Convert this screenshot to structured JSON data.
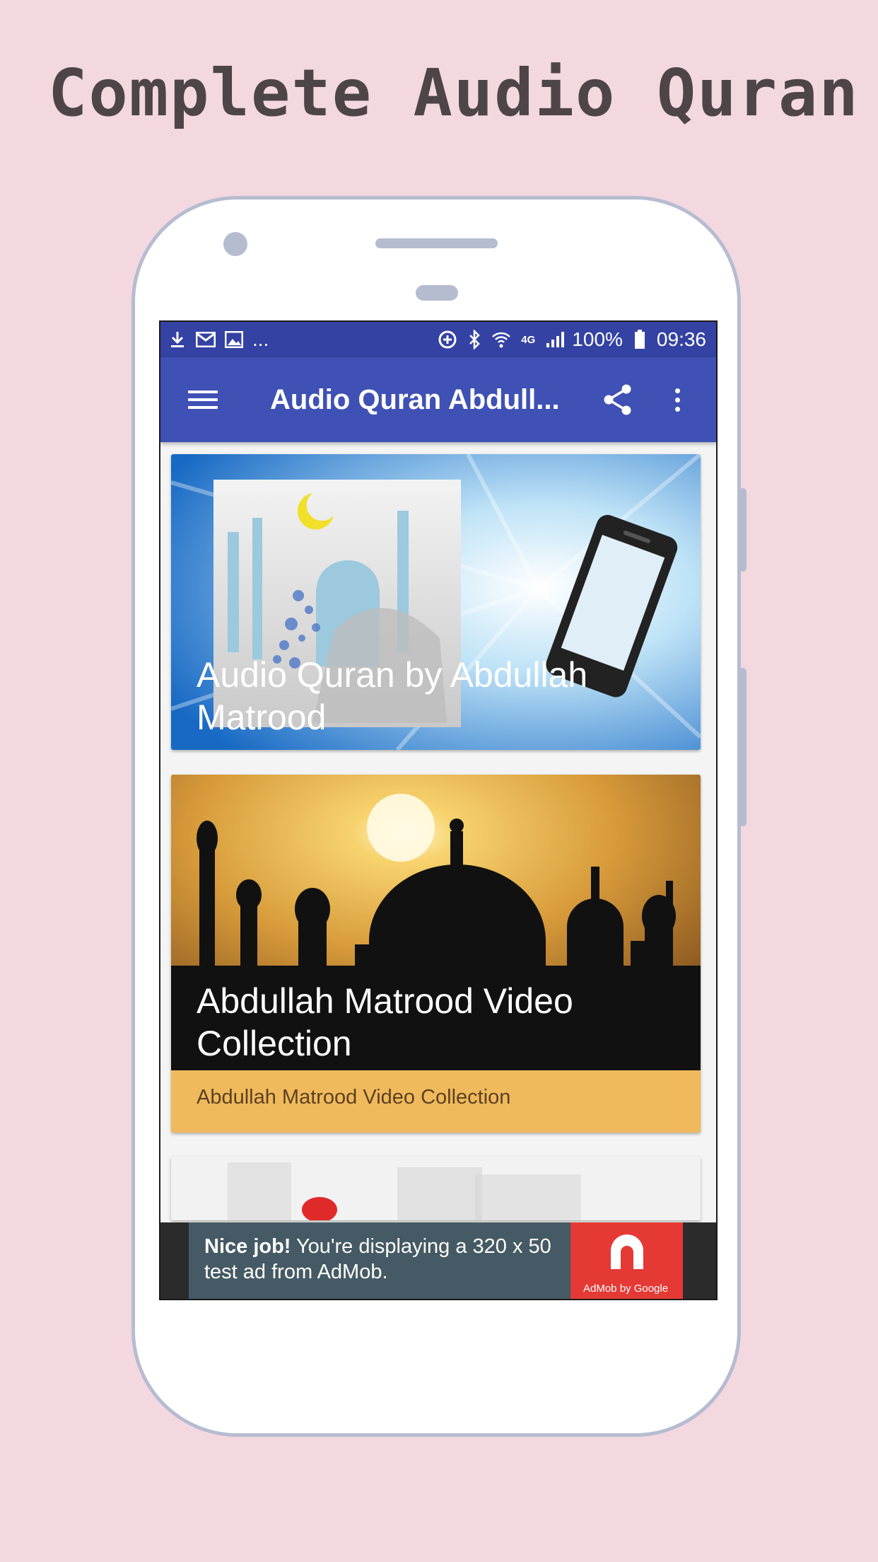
{
  "headline": "Complete Audio Quran",
  "status_bar": {
    "ellipsis": "...",
    "battery": "100%",
    "time": "09:36",
    "icons": [
      "download-icon",
      "gmail-icon",
      "image-icon",
      "sync-icon",
      "bluetooth-icon",
      "wifi-icon",
      "4g-icon",
      "signal-icon",
      "battery-icon"
    ]
  },
  "app_bar": {
    "title": "Audio Quran Abdull...",
    "icons": [
      "menu-icon",
      "share-icon",
      "more-vert-icon"
    ]
  },
  "cards": [
    {
      "title": "Audio Quran by Abdullah Matrood"
    },
    {
      "title": "Abdullah Matrood Video Collection",
      "subtitle": "Abdullah Matrood Video Collection"
    }
  ],
  "ad": {
    "bold": "Nice job!",
    "text": " You're displaying a 320 x 50 test ad from AdMob.",
    "logo_text": "AdMob by Google"
  },
  "colors": {
    "background": "#f3d8df",
    "status_bar": "#3442a3",
    "app_bar": "#3f51b5",
    "card2_footer": "#f0b95b",
    "ad_panel": "#455a64",
    "ad_logo": "#e53935"
  }
}
